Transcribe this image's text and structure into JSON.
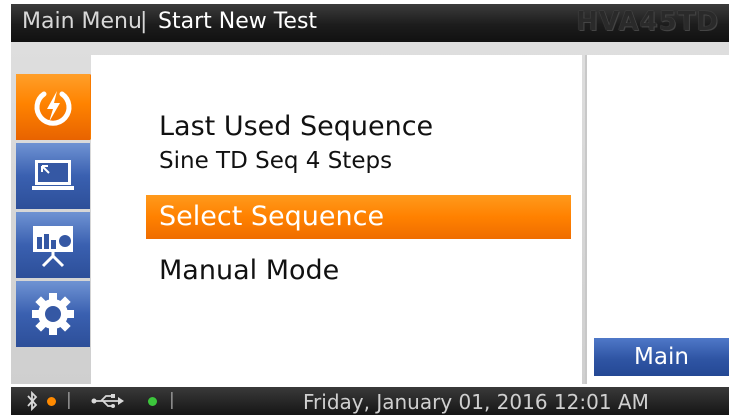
{
  "header": {
    "breadcrumb_root": "Main Menu",
    "separator": "|",
    "page_title": "Start New Test",
    "model_name": "HVA45TD"
  },
  "nav": {
    "items": [
      {
        "name": "start-test",
        "icon": "power-bolt-icon",
        "active": true
      },
      {
        "name": "monitor",
        "icon": "monitor-icon",
        "active": false
      },
      {
        "name": "presentation",
        "icon": "presentation-chart-icon",
        "active": false
      },
      {
        "name": "settings",
        "icon": "gear-icon",
        "active": false
      }
    ]
  },
  "main": {
    "last_used_title": "Last Used Sequence",
    "last_used_value": "Sine TD Seq 4 Steps",
    "menu": {
      "select_sequence": "Select Sequence",
      "manual_mode": "Manual Mode"
    },
    "selected_item": "Select Sequence"
  },
  "side": {
    "main_button": "Main"
  },
  "status": {
    "separator": "|",
    "datetime": "Friday, January 01, 2016 12:01 AM",
    "bluetooth_icon": "bluetooth-icon",
    "usb_icon": "usb-icon",
    "bluetooth_status_color": "#ff8a00",
    "usb_status_color": "#3cc63c"
  },
  "colors": {
    "accent": "#ff8300",
    "nav_blue": "#3a60b0",
    "button_blue": "#2f55a4"
  }
}
